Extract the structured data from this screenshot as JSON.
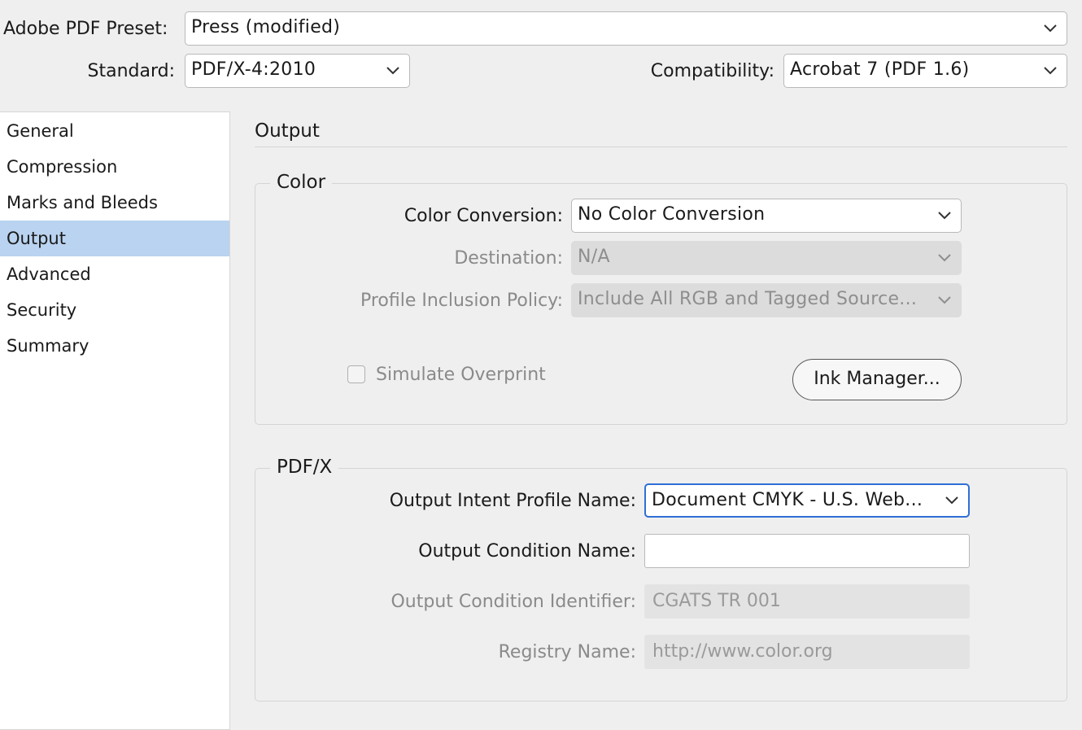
{
  "header": {
    "preset_label": "Adobe PDF Preset:",
    "preset_value": "Press (modified)",
    "standard_label": "Standard:",
    "standard_value": "PDF/X-4:2010",
    "compat_label": "Compatibility:",
    "compat_value": "Acrobat 7 (PDF 1.6)"
  },
  "sidebar": {
    "items": [
      {
        "label": "General"
      },
      {
        "label": "Compression"
      },
      {
        "label": "Marks and Bleeds"
      },
      {
        "label": "Output"
      },
      {
        "label": "Advanced"
      },
      {
        "label": "Security"
      },
      {
        "label": "Summary"
      }
    ],
    "selected": "Output"
  },
  "panel": {
    "title": "Output",
    "color": {
      "group_title": "Color",
      "conversion_label": "Color Conversion:",
      "conversion_value": "No Color Conversion",
      "destination_label": "Destination:",
      "destination_value": "N/A",
      "policy_label": "Profile Inclusion Policy:",
      "policy_value": "Include All RGB and Tagged Source...",
      "simulate_label": "Simulate Overprint",
      "ink_button": "Ink Manager..."
    },
    "pdfx": {
      "group_title": "PDF/X",
      "intent_label": "Output Intent Profile Name:",
      "intent_value": "Document CMYK - U.S. Web...",
      "condition_label": "Output Condition Name:",
      "condition_value": "",
      "identifier_label": "Output Condition Identifier:",
      "identifier_value": "CGATS TR 001",
      "registry_label": "Registry Name:",
      "registry_value": "http://www.color.org"
    }
  },
  "colors": {
    "selection": "#b9d3f0",
    "focus_ring": "#2f6fd6",
    "background": "#efefef"
  }
}
